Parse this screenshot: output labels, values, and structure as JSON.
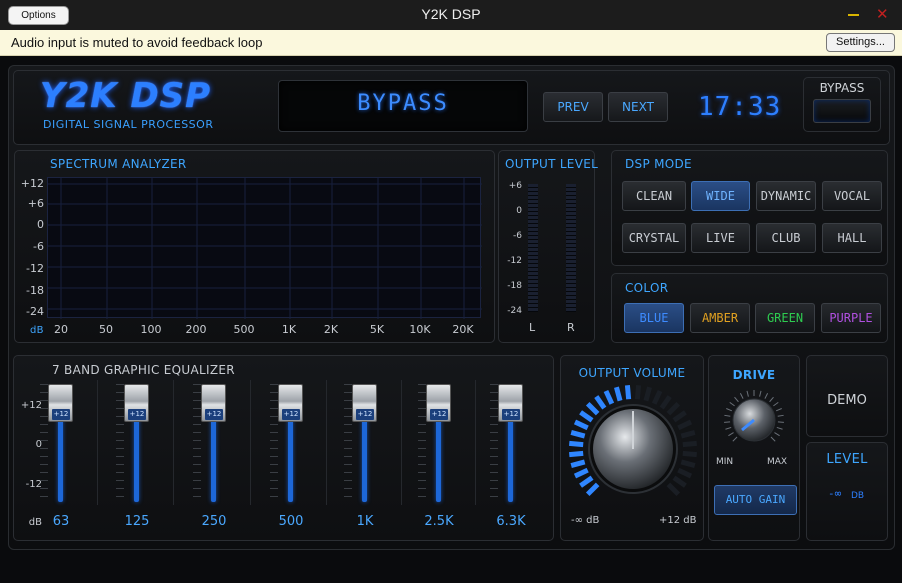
{
  "window": {
    "title": "Y2K DSP",
    "options_label": "Options",
    "min_icon": "minimize-icon",
    "close_icon": "close-icon",
    "close_glyph": "✕"
  },
  "notice": {
    "text": "Audio input is muted to avoid feedback loop",
    "settings_label": "Settings..."
  },
  "header": {
    "logo": "Y2K DSP",
    "subtitle": "DIGITAL SIGNAL PROCESSOR",
    "display": "BYPASS",
    "prev_label": "PREV",
    "next_label": "NEXT",
    "clock": "17:33",
    "bypass_label": "BYPASS"
  },
  "spectrum": {
    "title": "SPECTRUM ANALYZER",
    "y_ticks": [
      "+12",
      "+6",
      "0",
      "-6",
      "-12",
      "-18",
      "-24"
    ],
    "unit": "dB",
    "x_ticks": [
      "20",
      "50",
      "100",
      "200",
      "500",
      "1K",
      "2K",
      "5K",
      "10K",
      "20K"
    ]
  },
  "output_level": {
    "title": "OUTPUT LEVEL",
    "ticks": [
      "+6",
      "0",
      "-6",
      "-12",
      "-18",
      "-24"
    ],
    "left": "L",
    "right": "R"
  },
  "dsp_mode": {
    "title": "DSP MODE",
    "modes": [
      "CLEAN",
      "WIDE",
      "DYNAMIC",
      "VOCAL",
      "CRYSTAL",
      "LIVE",
      "CLUB",
      "HALL"
    ],
    "active": "WIDE"
  },
  "color": {
    "title": "COLOR",
    "options": [
      {
        "label": "BLUE",
        "color": "#3d8bff"
      },
      {
        "label": "AMBER",
        "color": "#e0a020"
      },
      {
        "label": "GREEN",
        "color": "#2ecc50"
      },
      {
        "label": "PURPLE",
        "color": "#b050e0"
      }
    ],
    "active": "BLUE"
  },
  "equalizer": {
    "title": "7 BAND GRAPHIC EQUALIZER",
    "scale": [
      "+12",
      "0",
      "-12"
    ],
    "unit": "dB",
    "bands": [
      {
        "freq": "63",
        "value": "+12"
      },
      {
        "freq": "125",
        "value": "+12"
      },
      {
        "freq": "250",
        "value": "+12"
      },
      {
        "freq": "500",
        "value": "+12"
      },
      {
        "freq": "1K",
        "value": "+12"
      },
      {
        "freq": "2.5K",
        "value": "+12"
      },
      {
        "freq": "6.3K",
        "value": "+12"
      }
    ]
  },
  "output_volume": {
    "title": "OUTPUT VOLUME",
    "min": "-∞ dB",
    "max": "+12 dB",
    "level": 0.5
  },
  "drive": {
    "title": "DRIVE",
    "min": "MIN",
    "max": "MAX",
    "auto_gain": "AUTO GAIN"
  },
  "demo": {
    "label": "DEMO"
  },
  "level": {
    "title": "LEVEL",
    "value": "-∞",
    "unit": "DB"
  },
  "colors": {
    "accent": "#3ea6ff",
    "active_mode": "#2b4e86"
  }
}
